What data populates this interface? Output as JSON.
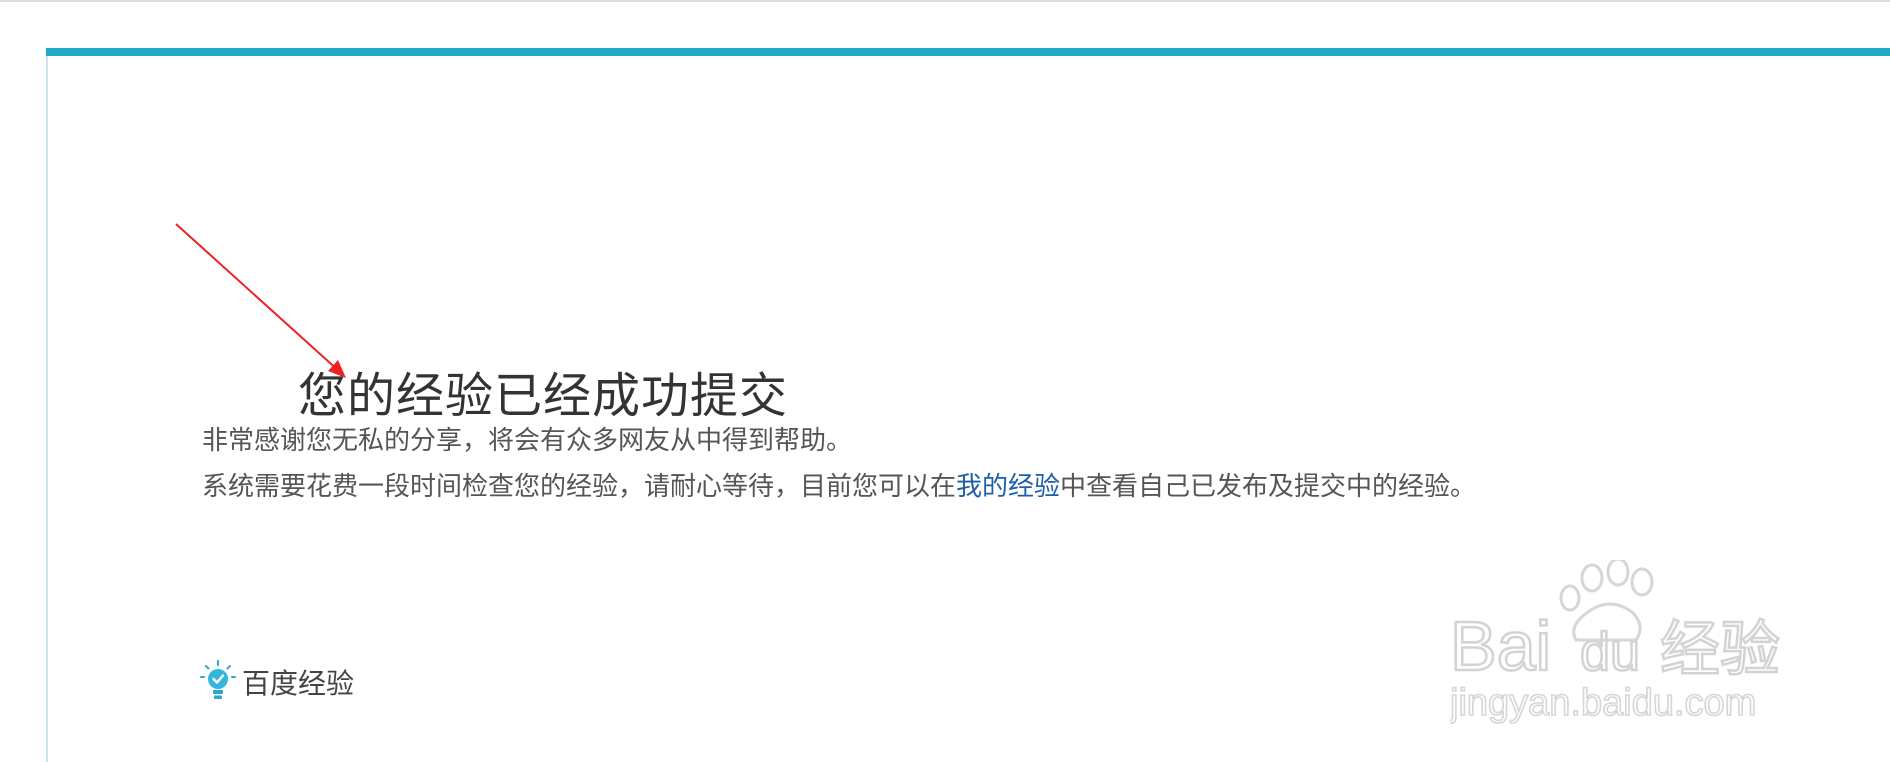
{
  "submission": {
    "title": "您的经验已经成功提交",
    "thanks": "非常感谢您无私的分享，将会有众多网友从中得到帮助。",
    "review_before": "系统需要花费一段时间检查您的经验，请耐心等待，目前您可以在",
    "my_experience_link": "我的经验",
    "review_after": "中查看自己已发布及提交中的经验。"
  },
  "brand": {
    "icon": "lightbulb-icon",
    "name": "百度经验"
  },
  "watermark": {
    "logo_text_left": "Bai",
    "logo_text_du": "du",
    "logo_text_cn": "经验",
    "url": "jingyan.baidu.com"
  },
  "colors": {
    "accent": "#22a9c9",
    "link": "#1d5fa8",
    "annotation_arrow": "#ee2222"
  }
}
